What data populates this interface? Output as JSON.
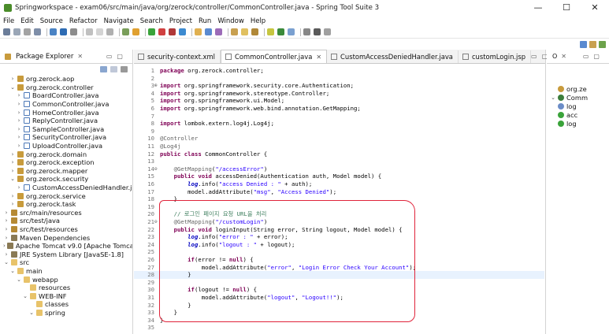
{
  "window": {
    "title": "Springworkspace - exam06/src/main/java/org/zerock/controller/CommonController.java - Spring Tool Suite 3",
    "minimize": "—",
    "maximize": "☐",
    "close": "✕"
  },
  "menu": [
    "File",
    "Edit",
    "Source",
    "Refactor",
    "Navigate",
    "Search",
    "Project",
    "Run",
    "Window",
    "Help"
  ],
  "package_explorer": {
    "title": "Package Explorer",
    "tree": [
      {
        "indent": 2,
        "twisty": ">",
        "icon": "pkg",
        "label": "org.zerock.aop"
      },
      {
        "indent": 2,
        "twisty": "v",
        "icon": "pkg",
        "label": "org.zerock.controller"
      },
      {
        "indent": 3,
        "twisty": ">",
        "icon": "java",
        "label": "BoardController.java"
      },
      {
        "indent": 3,
        "twisty": ">",
        "icon": "java",
        "label": "CommonController.java"
      },
      {
        "indent": 3,
        "twisty": ">",
        "icon": "java",
        "label": "HomeController.java"
      },
      {
        "indent": 3,
        "twisty": ">",
        "icon": "java",
        "label": "ReplyController.java"
      },
      {
        "indent": 3,
        "twisty": ">",
        "icon": "java",
        "label": "SampleController.java"
      },
      {
        "indent": 3,
        "twisty": ">",
        "icon": "java",
        "label": "SecurityController.java"
      },
      {
        "indent": 3,
        "twisty": ">",
        "icon": "java",
        "label": "UploadController.java"
      },
      {
        "indent": 2,
        "twisty": ">",
        "icon": "pkg",
        "label": "org.zerock.domain"
      },
      {
        "indent": 2,
        "twisty": ">",
        "icon": "pkg",
        "label": "org.zerock.exception"
      },
      {
        "indent": 2,
        "twisty": ">",
        "icon": "pkg",
        "label": "org.zerock.mapper"
      },
      {
        "indent": 2,
        "twisty": "v",
        "icon": "pkg",
        "label": "org.zerock.security"
      },
      {
        "indent": 3,
        "twisty": ">",
        "icon": "java",
        "label": "CustomAccessDeniedHandler.j"
      },
      {
        "indent": 2,
        "twisty": ">",
        "icon": "pkg",
        "label": "org.zerock.service"
      },
      {
        "indent": 2,
        "twisty": ">",
        "icon": "pkg",
        "label": "org.zerock.task"
      },
      {
        "indent": 1,
        "twisty": ">",
        "icon": "src",
        "label": "src/main/resources"
      },
      {
        "indent": 1,
        "twisty": ">",
        "icon": "src",
        "label": "src/test/java"
      },
      {
        "indent": 1,
        "twisty": ">",
        "icon": "src",
        "label": "src/test/resources"
      },
      {
        "indent": 1,
        "twisty": ">",
        "icon": "lib",
        "label": "Maven Dependencies"
      },
      {
        "indent": 1,
        "twisty": ">",
        "icon": "lib",
        "label": "Apache Tomcat v9.0 [Apache Tomca"
      },
      {
        "indent": 1,
        "twisty": ">",
        "icon": "lib",
        "label": "JRE System Library [JavaSE-1.8]"
      },
      {
        "indent": 1,
        "twisty": "v",
        "icon": "folder",
        "label": "src"
      },
      {
        "indent": 2,
        "twisty": "v",
        "icon": "folder",
        "label": "main"
      },
      {
        "indent": 3,
        "twisty": "v",
        "icon": "folder",
        "label": "webapp"
      },
      {
        "indent": 4,
        "twisty": "",
        "icon": "folder",
        "label": "resources"
      },
      {
        "indent": 4,
        "twisty": "v",
        "icon": "folder",
        "label": "WEB-INF"
      },
      {
        "indent": 5,
        "twisty": "",
        "icon": "folder",
        "label": "classes"
      },
      {
        "indent": 5,
        "twisty": "v",
        "icon": "folder",
        "label": "spring"
      }
    ]
  },
  "editor": {
    "tabs": [
      {
        "label": "security-context.xml",
        "active": false
      },
      {
        "label": "CommonController.java",
        "active": true
      },
      {
        "label": "CustomAccessDeniedHandler.java",
        "active": false
      },
      {
        "label": "customLogin.jsp",
        "active": false
      }
    ],
    "lines": [
      {
        "n": "1",
        "html": "<span class='k'>package</span> org.zerock.controller;"
      },
      {
        "n": "2",
        "html": ""
      },
      {
        "n": "3",
        "marker": "⊕",
        "html": "<span class='k'>import</span> org.springframework.security.core.Authentication;"
      },
      {
        "n": "4",
        "html": "<span class='k'>import</span> org.springframework.stereotype.Controller;"
      },
      {
        "n": "5",
        "html": "<span class='k'>import</span> org.springframework.ui.Model;"
      },
      {
        "n": "6",
        "html": "<span class='k'>import</span> org.springframework.web.bind.annotation.GetMapping;"
      },
      {
        "n": "7",
        "html": ""
      },
      {
        "n": "8",
        "html": "<span class='k'>import</span> lombok.extern.log4j.Log4j;"
      },
      {
        "n": "9",
        "html": ""
      },
      {
        "n": "10",
        "html": "<span class='a'>@Controller</span>"
      },
      {
        "n": "11",
        "html": "<span class='a'>@Log4j</span>"
      },
      {
        "n": "12",
        "html": "<span class='k'>public</span> <span class='k'>class</span> CommonController {"
      },
      {
        "n": "13",
        "html": ""
      },
      {
        "n": "14",
        "marker": "⊖",
        "html": "    <span class='a'>@GetMapping</span>(<span class='s'>\"/accessError\"</span>)"
      },
      {
        "n": "15",
        "html": "    <span class='k'>public</span> <span class='k'>void</span> accessDenied(Authentication auth, Model model) {"
      },
      {
        "n": "16",
        "html": "        <span class='i'>log</span>.info(<span class='s'>\"access Denied : \"</span> + auth);"
      },
      {
        "n": "17",
        "html": "        model.addAttribute(<span class='s'>\"msg\"</span>, <span class='s'>\"Access Denied\"</span>);"
      },
      {
        "n": "18",
        "html": "    }"
      },
      {
        "n": "19",
        "html": ""
      },
      {
        "n": "20",
        "html": "    <span class='c'>// 로그인 페이지 요청 URL을 처리</span>"
      },
      {
        "n": "21",
        "marker": "⊖",
        "html": "    <span class='a'>@GetMapping</span>(<span class='s'>\"/customLogin\"</span>)"
      },
      {
        "n": "22",
        "html": "    <span class='k'>public</span> <span class='k'>void</span> loginInput(String error, String logout, Model model) {"
      },
      {
        "n": "23",
        "html": "        <span class='i'>log</span>.info(<span class='s'>\"error : \"</span> + error);"
      },
      {
        "n": "24",
        "html": "        <span class='i'>log</span>.info(<span class='s'>\"logout : \"</span> + logout);"
      },
      {
        "n": "25",
        "html": ""
      },
      {
        "n": "26",
        "html": "        <span class='k'>if</span>(error != <span class='k'>null</span>) {"
      },
      {
        "n": "27",
        "html": "            model.addAttribute(<span class='s'>\"error\"</span>, <span class='s'>\"Login Error Check Your Account\"</span>);"
      },
      {
        "n": "28",
        "html": "        }",
        "current": true
      },
      {
        "n": "29",
        "html": ""
      },
      {
        "n": "30",
        "html": "        <span class='k'>if</span>(logout != <span class='k'>null</span>) {"
      },
      {
        "n": "31",
        "html": "            model.addAttribute(<span class='s'>\"logout\"</span>, <span class='s'>\"Logout!!\"</span>);"
      },
      {
        "n": "32",
        "html": "        }"
      },
      {
        "n": "33",
        "html": "    }"
      },
      {
        "n": "34",
        "html": "}"
      },
      {
        "n": "35",
        "html": ""
      }
    ]
  },
  "outline": {
    "items": [
      {
        "twisty": "",
        "icon": "#c89b3c",
        "label": "org.ze"
      },
      {
        "twisty": "v",
        "icon": "#3b7d3b",
        "label": "Comm"
      },
      {
        "twisty": "",
        "icon": "#6b8cc7",
        "label": "log"
      },
      {
        "twisty": "",
        "icon": "#3aa33a",
        "label": "acc"
      },
      {
        "twisty": "",
        "icon": "#3aa33a",
        "label": "log"
      }
    ]
  },
  "colors": {
    "annotation_box": "#e0233a",
    "current_line": "#e8f2fe",
    "keyword": "#7f0055",
    "string": "#2a00ff"
  }
}
